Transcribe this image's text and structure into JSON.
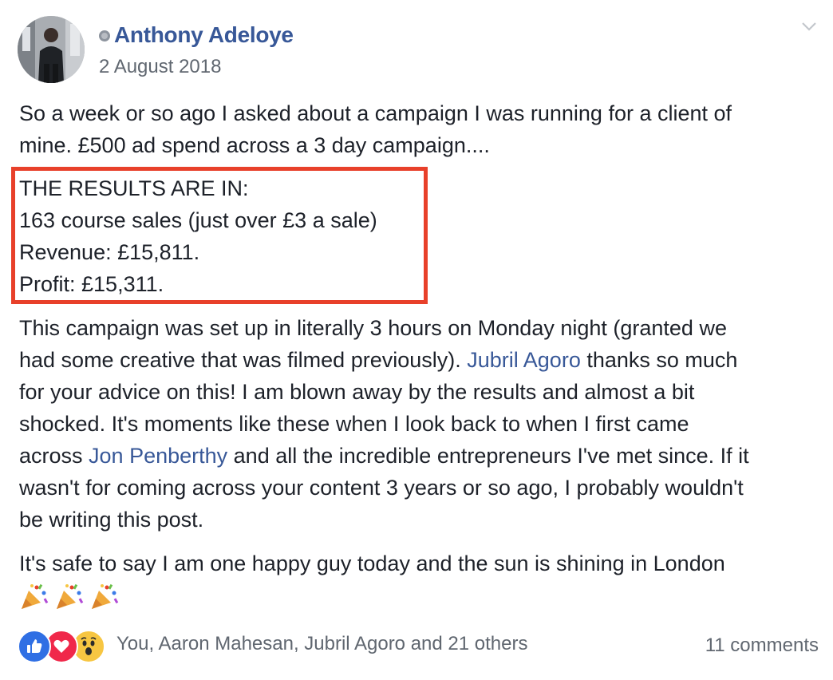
{
  "post": {
    "author": "Anthony Adeloye",
    "date": "2 August 2018",
    "intro_lines": [
      "So a week or so ago I asked about a campaign I was running for a client of",
      "mine. £500 ad spend across a 3 day campaign...."
    ],
    "results_lines": [
      "THE RESULTS ARE IN:",
      "163 course sales (just over £3 a sale)",
      "Revenue: £15,811.",
      "Profit: £15,311."
    ],
    "body": {
      "l1": "This campaign was set up in literally 3 hours on Monday night (granted we",
      "l2_a": "had some creative that was filmed previously). ",
      "l2_mention": "Jubril Agoro",
      "l2_b": " thanks so much",
      "l3": "for your advice on this! I am blown away by the results and almost a bit",
      "l4": "shocked. It's moments like these when I look back to when I first came",
      "l5_a": "across ",
      "l5_mention": "Jon Penberthy",
      "l5_b": " and all the incredible entrepreneurs I've met since. If it",
      "l6": "wasn't for coming across your content 3 years or so ago, I probably wouldn't",
      "l7": "be writing this post."
    },
    "closing": "It's safe to say I am one happy guy today and the sun is shining in London",
    "emojis": [
      "party-popper",
      "party-popper",
      "party-popper"
    ]
  },
  "footer": {
    "reactions": [
      "like",
      "love",
      "wow"
    ],
    "reaction_summary": "You, Aaron Mahesan, Jubril Agoro and 21 others",
    "comments": "11 comments"
  },
  "colors": {
    "link": "#385898",
    "text": "#1d2129",
    "meta": "#606770",
    "highlight_border": "#e8402a",
    "like": "#2f6fe4",
    "love": "#f0284a",
    "wow": "#f7c642"
  }
}
